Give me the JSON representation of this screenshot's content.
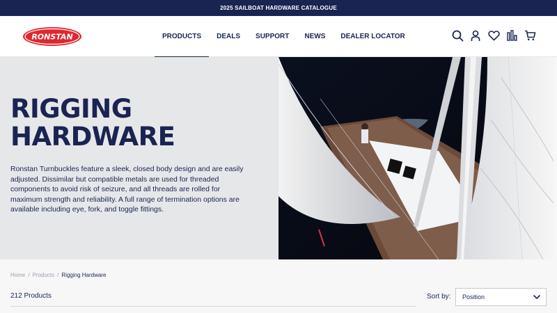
{
  "topbar": {
    "text": "2025 SAILBOAT HARDWARE CATALOGUE"
  },
  "logo": {
    "text": "RONSTAN"
  },
  "nav": {
    "items": [
      {
        "label": "PRODUCTS"
      },
      {
        "label": "DEALS"
      },
      {
        "label": "SUPPORT"
      },
      {
        "label": "NEWS"
      },
      {
        "label": "DEALER LOCATOR"
      }
    ]
  },
  "header_icons": [
    "search-icon",
    "account-icon",
    "wishlist-heart-icon",
    "compare-chart-icon",
    "cart-icon"
  ],
  "hero": {
    "title_line1": "RIGGING",
    "title_line2": "HARDWARE",
    "description": "Ronstan Turnbuckles feature a sleek, closed body design and are easily adjusted. Dissimilar but compatible metals are used for threaded components to avoid risk of seizure, and all threads are rolled for maximum strength and reliability. A full range of termination options are available including eye, fork, and toggle fittings."
  },
  "breadcrumb": {
    "home": "Home",
    "sep": "/",
    "products": "Products",
    "current": "Rigging Hardware"
  },
  "listing": {
    "count": "212 Products",
    "sort_label": "Sort by:",
    "sort_value": "Position"
  },
  "colors": {
    "navy": "#1a2452",
    "brand_red": "#e0262f",
    "hero_bg": "#e6e7e9"
  }
}
